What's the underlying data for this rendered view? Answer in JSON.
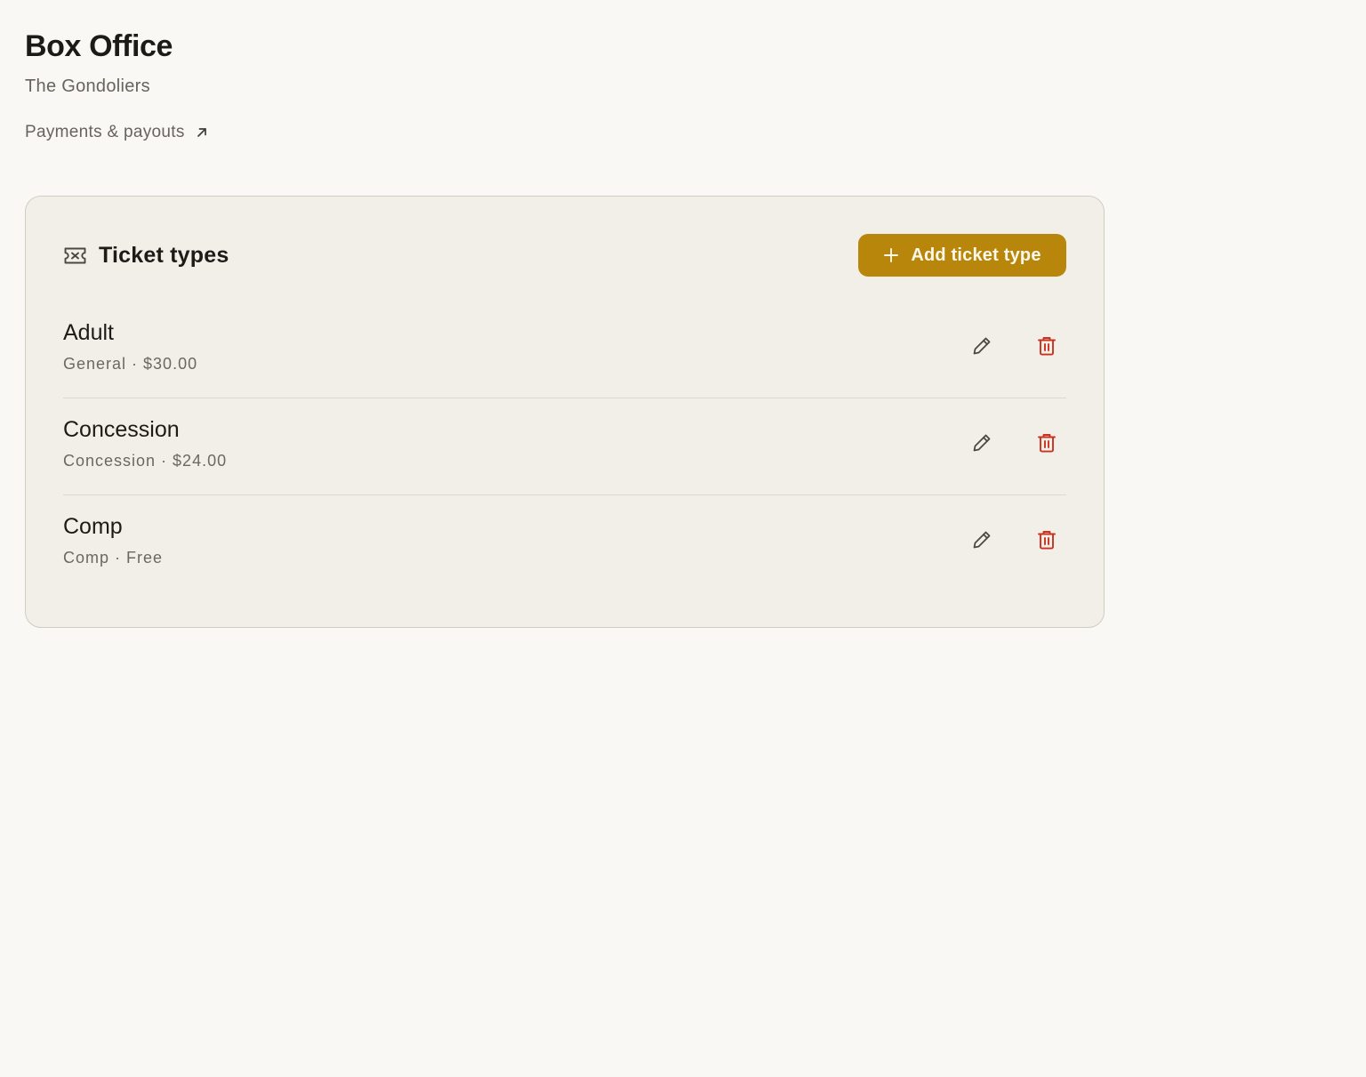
{
  "header": {
    "title": "Box Office",
    "subtitle": "The Gondoliers",
    "payments_link_label": "Payments & payouts",
    "payments_link_icon": "arrow-up-right-icon"
  },
  "ticket_types_panel": {
    "title": "Ticket types",
    "title_icon": "ticket-icon",
    "add_button_label": "Add ticket type",
    "add_button_icon": "plus-icon",
    "items": [
      {
        "name": "Adult",
        "category": "General",
        "price": "$30.00",
        "meta": "General · $30.00",
        "edit_icon": "pencil-icon",
        "delete_icon": "trash-icon"
      },
      {
        "name": "Concession",
        "category": "Concession",
        "price": "$24.00",
        "meta": "Concession · $24.00",
        "edit_icon": "pencil-icon",
        "delete_icon": "trash-icon"
      },
      {
        "name": "Comp",
        "category": "Comp",
        "price": "Free",
        "meta": "Comp · Free",
        "edit_icon": "pencil-icon",
        "delete_icon": "trash-icon"
      }
    ]
  },
  "colors": {
    "background": "#f9f8f4",
    "panel_background": "#f2efe8",
    "panel_border": "#cfccc3",
    "accent": "#b8860b",
    "accent_text": "#fdf8ec",
    "text_primary": "#1c1b18",
    "text_secondary": "#67645d",
    "danger": "#c8321e",
    "divider": "#dcd8cf"
  }
}
